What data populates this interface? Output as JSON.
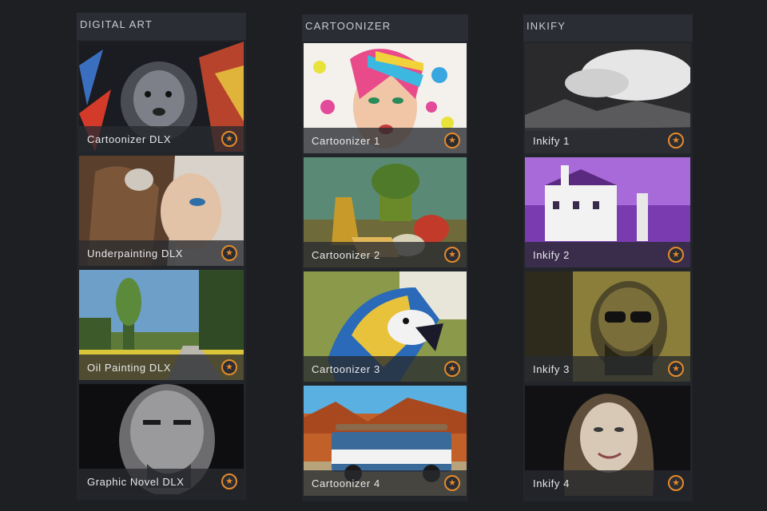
{
  "columns": [
    {
      "title": "DIGITAL ART",
      "items": [
        {
          "label": "Cartoonizer DLX"
        },
        {
          "label": "Underpainting DLX"
        },
        {
          "label": "Oil Painting DLX"
        },
        {
          "label": "Graphic Novel DLX"
        }
      ]
    },
    {
      "title": "CARTOONIZER",
      "items": [
        {
          "label": "Cartoonizer 1"
        },
        {
          "label": "Cartoonizer 2"
        },
        {
          "label": "Cartoonizer 3"
        },
        {
          "label": "Cartoonizer 4"
        }
      ]
    },
    {
      "title": "INKIFY",
      "items": [
        {
          "label": "Inkify 1"
        },
        {
          "label": "Inkify 2"
        },
        {
          "label": "Inkify 3"
        },
        {
          "label": "Inkify 4"
        }
      ]
    }
  ],
  "icons": {
    "favorite": "star-icon"
  },
  "colors": {
    "accent": "#e38a2c",
    "background": "#1d1f23",
    "panel": "#22252a"
  }
}
